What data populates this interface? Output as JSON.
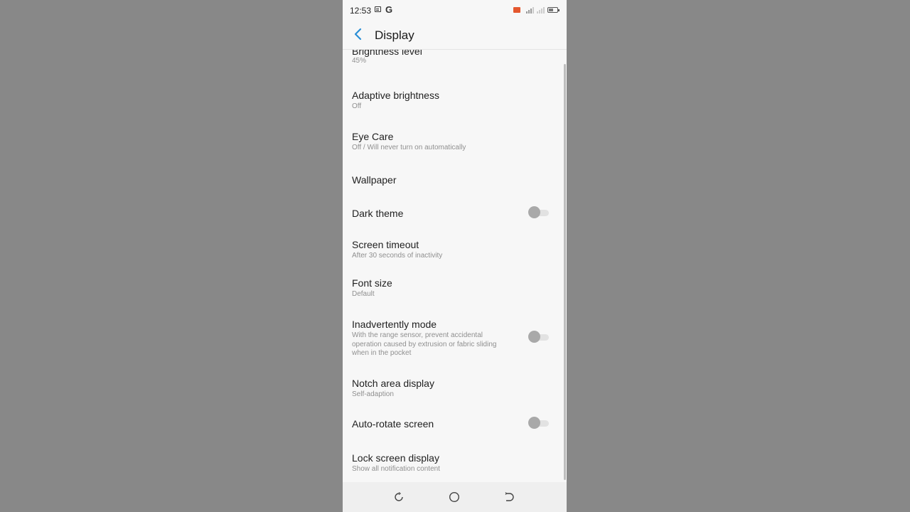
{
  "status_bar": {
    "time": "12:53",
    "battery_level": 0.55
  },
  "header": {
    "title": "Display"
  },
  "settings": [
    {
      "title": "Brightness level",
      "subtitle": "45%"
    },
    {
      "title": "Adaptive brightness",
      "subtitle": "Off"
    },
    {
      "title": "Eye Care",
      "subtitle": "Off / Will never turn on automatically"
    },
    {
      "title": "Wallpaper"
    },
    {
      "title": "Dark theme",
      "toggle": false
    },
    {
      "title": "Screen timeout",
      "subtitle": "After 30 seconds of inactivity"
    },
    {
      "title": "Font size",
      "subtitle": "Default"
    },
    {
      "title": "Inadvertently mode",
      "subtitle": "With the range sensor, prevent accidental operation caused by extrusion or fabric sliding when in the pocket",
      "toggle": false
    },
    {
      "title": "Notch area display",
      "subtitle": "Self-adaption"
    },
    {
      "title": "Auto-rotate screen",
      "toggle": false
    },
    {
      "title": "Lock screen display",
      "subtitle": "Show all notification content"
    }
  ],
  "colors": {
    "accent": "#2a8fd6",
    "background": "#f7f7f7",
    "outer_background": "#878787"
  },
  "icons": {
    "back": "chevron-left-icon",
    "nav_recents": "recents-icon",
    "nav_home": "home-icon",
    "nav_back": "back-icon"
  }
}
